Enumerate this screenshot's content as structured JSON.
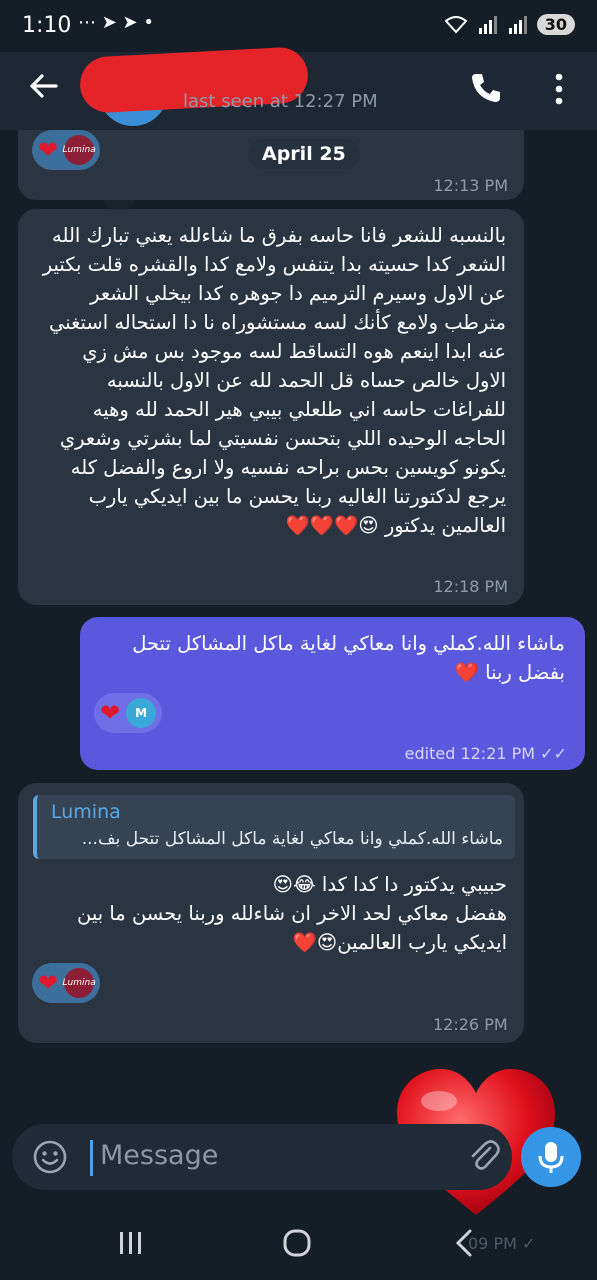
{
  "status_bar": {
    "time": "1:10",
    "notification_icons": "⋯ ➤ ➤ •",
    "battery": "30"
  },
  "header": {
    "last_seen": "last seen at 12:27 PM"
  },
  "messages": [
    {
      "reaction_avatar": "Lumina",
      "date_label": "April 25",
      "time": "12:13 PM"
    },
    {
      "text": "بالنسبه للشعر فانا حاسه بفرق ما شاءلله يعني تبارك الله الشعر كدا حسيته بدا يتنفس ولامع كدا والقشره قلت بكتير عن الاول وسيرم الترميم دا جوهره كدا بيخلي الشعر مترطب ولامع كأنك لسه مستشوراه نا دا استحاله استغني عنه ابدا اينعم هوه التساقط لسه موجود بس مش زي الاول خالص حساه قل الحمد لله عن الاول بالنسبه للفراغات حاسه اني طلعلي بيبي هير الحمد لله وهيه الحاجه الوحيده اللي بتحسن نفسيتي لما بشرتي وشعري يكونو كويسين بحس براحه نفسيه ولا اروع والفضل كله يرجع لدكتورتنا الغاليه ربنا يحسن ما بين ايديكي يارب العالمين يدكتور 😍❤️❤️❤️",
      "time": "12:18 PM"
    },
    {
      "text": "ماشاء الله.كملي وانا معاكي لغاية ماكل المشاكل تتحل بفضل ربنا ❤️",
      "reaction_avatar": "M",
      "time": "edited 12:21 PM ✓✓"
    },
    {
      "reply_name": "Lumina",
      "reply_text": "ماشاء الله.كملي وانا معاكي لغاية ماكل المشاكل تتحل بف...",
      "text": "حبيبي يدكتور دا كدا كدا 😂😍\nهفضل معاكي لحد الاخر ان شاءلله وربنا يحسن ما بين ايديكي يارب العالمين😍❤️",
      "reaction_avatar": "Lumina",
      "time": "12:26 PM"
    }
  ],
  "input": {
    "placeholder": "Message"
  },
  "ghost_time": "09 PM ✓",
  "colors": {
    "incoming_bubble": "#2b3542",
    "outgoing_bubble": "#5a58dd",
    "accent": "#3696e6",
    "reply_name": "#5aa7e8",
    "reaction_heart": "#e0182d"
  },
  "icons": [
    "back-arrow-icon",
    "phone-icon",
    "more-vert-icon",
    "heart-icon",
    "emoji-icon",
    "paperclip-icon",
    "microphone-icon",
    "recents-icon",
    "home-icon",
    "back-nav-icon",
    "wifi-icon",
    "signal-icon"
  ]
}
